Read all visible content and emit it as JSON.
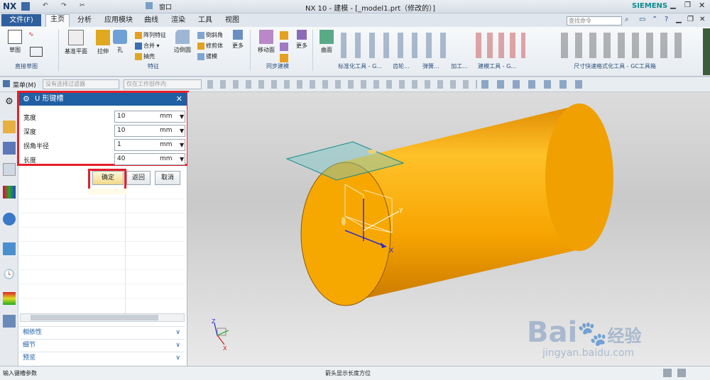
{
  "app": {
    "logo": "NX",
    "title": "NX 10 - 建模 - [_model1.prt（修改的）]",
    "brand": "SIEMENS",
    "window_menu": "窗口"
  },
  "ribbon_tabs": [
    "文件(F)",
    "主页",
    "分析",
    "应用模块",
    "曲线",
    "渲染",
    "工具",
    "视图"
  ],
  "search_placeholder": "查找命令",
  "ribbon_groups": [
    "直接草图",
    "特征",
    "同步建模",
    "标准化工具 - G...",
    "齿轮...",
    "弹簧...",
    "加工...",
    "建模工具 - G...",
    "尺寸快速格式化工具 - GC工具箱"
  ],
  "ribbon_buttons": {
    "sketch": "草图",
    "datum": "基准平面",
    "extrude": "拉伸",
    "hole": "孔",
    "pattern": "阵列特征",
    "unite": "合并",
    "shell": "抽壳",
    "edge_blend": "边倒圆",
    "chamfer": "倒斜角",
    "trim": "修剪体",
    "draft": "拔模",
    "more1": "更多",
    "move_face": "移动面",
    "more2": "更多",
    "surface": "曲面",
    "more3": "更多"
  },
  "toolbar2": {
    "menu": "菜单(M)",
    "filter1": "没有选择过滤器",
    "filter2": "仅在工作部件内"
  },
  "dialog": {
    "title": "U 形键槽",
    "fields": [
      {
        "label": "宽度",
        "value": "10",
        "unit": "mm"
      },
      {
        "label": "深度",
        "value": "10",
        "unit": "mm"
      },
      {
        "label": "拐角半径",
        "value": "1",
        "unit": "mm"
      },
      {
        "label": "长度",
        "value": "40",
        "unit": "mm"
      }
    ],
    "ok": "确定",
    "back": "返回",
    "cancel": "取消"
  },
  "panel_sections": [
    "相依性",
    "细节",
    "预览"
  ],
  "status": {
    "left": "输入键槽参数",
    "center": "箭头显示长度方位"
  },
  "axes": {
    "x": "X",
    "y": "Y",
    "z": "Z"
  },
  "watermark": {
    "main": "Bai",
    "mid": "经验",
    "url": "jingyan.baidu.com"
  },
  "colors": {
    "accent": "#1f5fa3",
    "cylinder": "#f5a300",
    "highlight": "#e5202a"
  }
}
